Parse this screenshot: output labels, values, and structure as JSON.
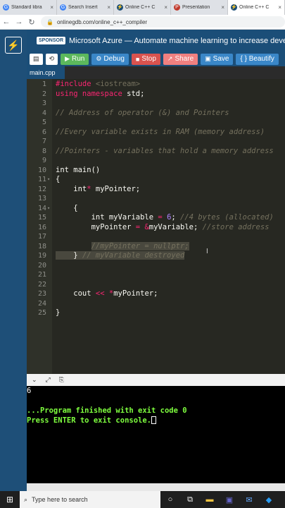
{
  "browser": {
    "tabs": [
      {
        "title": "Standard libra",
        "fav": "G",
        "color": "#444"
      },
      {
        "title": "Search Insert",
        "fav": "G",
        "color": "#444"
      },
      {
        "title": "Online C++ C",
        "fav": "⚡",
        "color": "#1b4e78"
      },
      {
        "title": "Presentation",
        "fav": "P",
        "color": "#c0392b"
      },
      {
        "title": "Online C++ C",
        "fav": "⚡",
        "color": "#1b4e78"
      }
    ],
    "url": "onlinegdb.com/online_c++_compiler"
  },
  "sponsor": {
    "badge": "SPONSOR",
    "text": "Microsoft Azure — Automate machine learning to increase develo"
  },
  "toolbar": {
    "run": "Run",
    "debug": "Debug",
    "stop": "Stop",
    "share": "Share",
    "save": "Save",
    "beautify": "{ } Beautify"
  },
  "file": {
    "name": "main.cpp"
  },
  "editor": {
    "line_numbers": [
      "1",
      "2",
      "3",
      "4",
      "5",
      "6",
      "7",
      "8",
      "9",
      "10",
      "11",
      "12",
      "13",
      "14",
      "15",
      "16",
      "17",
      "18",
      "19",
      "20",
      "21",
      "22",
      "23",
      "24",
      "25"
    ]
  },
  "console": {
    "output": "6",
    "finished": "...Program finished with exit code 0",
    "press": "Press ENTER to exit console."
  },
  "taskbar": {
    "search_placeholder": "Type here to search"
  }
}
